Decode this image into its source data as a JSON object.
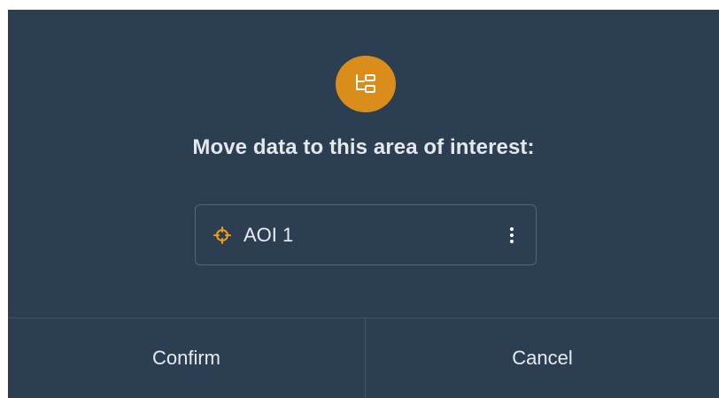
{
  "dialog": {
    "header_icon": "hierarchy-move-icon",
    "title": "Move data to this area of interest:",
    "aoi": {
      "icon": "crosshair-target-icon",
      "label": "AOI 1",
      "menu_icon": "more-vertical-icon"
    },
    "buttons": {
      "confirm": "Confirm",
      "cancel": "Cancel"
    }
  },
  "colors": {
    "background": "#2b3e52",
    "accent": "#db8d1c",
    "divider": "#3f5267",
    "text": "#e6ebf0"
  }
}
